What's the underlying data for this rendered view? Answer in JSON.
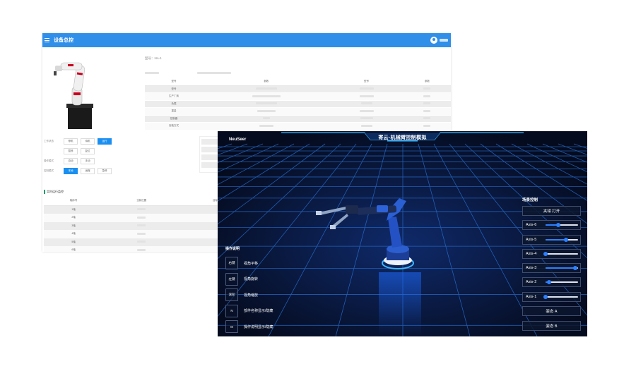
{
  "device_panel": {
    "title": "设备总控",
    "model_label": "型号：NA-1",
    "spec_header": [
      "型号",
      "参数",
      "型号",
      "参数"
    ],
    "spec_labels": [
      "型号",
      "生产厂商",
      "负载",
      "重量",
      "控制器",
      "安装方式"
    ],
    "controls": [
      {
        "label": "工作状态",
        "buttons": [
          {
            "text": "停机",
            "active": false
          },
          {
            "text": "待机",
            "active": false
          },
          {
            "text": "运行",
            "active": true
          }
        ]
      },
      {
        "label": "",
        "buttons": [
          {
            "text": "暂停",
            "active": false
          },
          {
            "text": "复位",
            "active": false
          }
        ]
      },
      {
        "label": "操作模式",
        "buttons": [
          {
            "text": "自动",
            "active": false
          },
          {
            "text": "手动",
            "active": false
          }
        ]
      },
      {
        "label": "控制模式",
        "buttons": [
          {
            "text": "本地",
            "active": true
          },
          {
            "text": "远程",
            "active": false
          },
          {
            "text": "急停",
            "active": false
          }
        ]
      }
    ],
    "section_title": "实时运行监控",
    "monitor_header": [
      "轴序号",
      "当前位置",
      "目标位置"
    ],
    "monitor_rows": [
      "1轴",
      "2轴",
      "3轴",
      "4轴",
      "5轴",
      "6轴"
    ]
  },
  "simulator": {
    "logo": "NeuSeer",
    "title": "寄云-机械臂控制模拟",
    "ops_title": "操作说明",
    "ops": [
      {
        "key": "右键",
        "desc": "视角平移"
      },
      {
        "key": "左键",
        "desc": "视角旋转"
      },
      {
        "key": "滚轮",
        "desc": "视角缩放"
      },
      {
        "key": "N",
        "desc": "部件名称显示/隐藏"
      },
      {
        "key": "M",
        "desc": "操作说明显示/隐藏"
      }
    ],
    "scene_title": "场景控制",
    "gripper_button": "夹钳 打开",
    "axes": [
      {
        "name": "Axis-6",
        "level": 0.4
      },
      {
        "name": "Axis-5",
        "level": 0.62
      },
      {
        "name": "Axis-4",
        "level": 0.0
      },
      {
        "name": "Axis-3",
        "level": 0.92
      },
      {
        "name": "Axis-2",
        "level": 0.1
      },
      {
        "name": "Axis-1",
        "level": 0.0
      }
    ],
    "pose_a": "姿态 A",
    "pose_b": "姿态 B",
    "colors": {
      "accent": "#2d80ff",
      "grid": "#2a73d8",
      "bg": "#050b1e"
    }
  }
}
